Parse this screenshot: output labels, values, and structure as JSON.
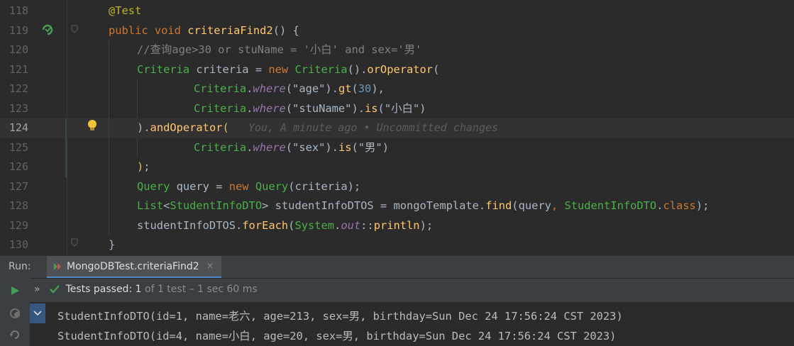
{
  "editor": {
    "lines": [
      {
        "no": "118",
        "tokens": [
          [
            "ann",
            "@Test"
          ]
        ],
        "indent": 0
      },
      {
        "no": "119",
        "tokens": [
          [
            "kw",
            "public "
          ],
          [
            "kw",
            "void "
          ],
          [
            "fn",
            "criteriaFind2"
          ],
          [
            "var",
            "() {"
          ]
        ],
        "indent": 0
      },
      {
        "no": "120",
        "tokens": [
          [
            "cmt",
            "//查询age>30 or stuName = '小白' and sex='男'"
          ]
        ],
        "indent": 1
      },
      {
        "no": "121",
        "tokens": [
          [
            "green",
            "Criteria "
          ],
          [
            "var",
            "criteria "
          ],
          [
            "var",
            "= "
          ],
          [
            "kw",
            "new "
          ],
          [
            "green",
            "Criteria"
          ],
          [
            "var",
            "()."
          ],
          [
            "meth",
            "orOperator"
          ],
          [
            "var",
            "("
          ]
        ],
        "indent": 1
      },
      {
        "no": "122",
        "tokens": [
          [
            "green",
            "Criteria"
          ],
          [
            "var",
            "."
          ],
          [
            "static",
            "where"
          ],
          [
            "var",
            "("
          ],
          [
            "str",
            "\"age\""
          ],
          [
            "var",
            ")."
          ],
          [
            "meth",
            "gt"
          ],
          [
            "var",
            "("
          ],
          [
            "num",
            "30"
          ],
          [
            "var",
            "),"
          ]
        ],
        "indent": 3
      },
      {
        "no": "123",
        "tokens": [
          [
            "green",
            "Criteria"
          ],
          [
            "var",
            "."
          ],
          [
            "static",
            "where"
          ],
          [
            "var",
            "("
          ],
          [
            "str",
            "\"stuName\""
          ],
          [
            "var",
            ")."
          ],
          [
            "meth",
            "is"
          ],
          [
            "var",
            "("
          ],
          [
            "str",
            "\"小白\""
          ],
          [
            "var",
            ")"
          ]
        ],
        "indent": 3
      },
      {
        "no": "124",
        "tokens": [
          [
            "var",
            ")."
          ],
          [
            "meth",
            "andOperator"
          ],
          [
            "paren",
            "("
          ]
        ],
        "indent": 1,
        "inlay": "You, A minute ago • Uncommitted changes",
        "current": true
      },
      {
        "no": "125",
        "tokens": [
          [
            "green",
            "Criteria"
          ],
          [
            "var",
            "."
          ],
          [
            "static",
            "where"
          ],
          [
            "var",
            "("
          ],
          [
            "str",
            "\"sex\""
          ],
          [
            "var",
            ")."
          ],
          [
            "meth",
            "is"
          ],
          [
            "var",
            "("
          ],
          [
            "str",
            "\"男\""
          ],
          [
            "var",
            ")"
          ]
        ],
        "indent": 3
      },
      {
        "no": "126",
        "tokens": [
          [
            "paren",
            ")"
          ],
          [
            "var",
            ";"
          ]
        ],
        "indent": 1
      },
      {
        "no": "127",
        "tokens": [
          [
            "green",
            "Query "
          ],
          [
            "var",
            "query "
          ],
          [
            "var",
            "= "
          ],
          [
            "kw",
            "new "
          ],
          [
            "green",
            "Query"
          ],
          [
            "var",
            "("
          ],
          [
            "var",
            "criteria"
          ],
          [
            "var",
            ");"
          ]
        ],
        "indent": 1
      },
      {
        "no": "128",
        "tokens": [
          [
            "green",
            "List"
          ],
          [
            "var",
            "<"
          ],
          [
            "green",
            "StudentInfoDTO"
          ],
          [
            "var",
            "> "
          ],
          [
            "var",
            "studentInfoDTOS "
          ],
          [
            "var",
            "= "
          ],
          [
            "var",
            "mongoTemplate"
          ],
          [
            "var",
            "."
          ],
          [
            "meth",
            "find"
          ],
          [
            "var",
            "("
          ],
          [
            "var",
            "query"
          ],
          [
            "kw",
            ", "
          ],
          [
            "green",
            "StudentInfoDTO"
          ],
          [
            "var",
            "."
          ],
          [
            "kw",
            "class"
          ],
          [
            "var",
            ");"
          ]
        ],
        "indent": 1
      },
      {
        "no": "129",
        "tokens": [
          [
            "var",
            "studentInfoDTOS"
          ],
          [
            "var",
            "."
          ],
          [
            "meth",
            "forEach"
          ],
          [
            "var",
            "("
          ],
          [
            "green",
            "System"
          ],
          [
            "var",
            "."
          ],
          [
            "field",
            "out"
          ],
          [
            "var",
            "::"
          ],
          [
            "meth",
            "println"
          ],
          [
            "var",
            ");"
          ]
        ],
        "indent": 1
      },
      {
        "no": "130",
        "tokens": [
          [
            "var",
            "}"
          ]
        ],
        "indent": 0
      }
    ]
  },
  "run_panel": {
    "label": "Run:",
    "tab_label": "MongoDBTest.criteriaFind2",
    "tab_close": "×",
    "expand_glyph": "»",
    "tests_passed": "Tests passed:",
    "tests_count": "1",
    "tests_detail": "of 1 test – 1 sec 60 ms",
    "output": [
      "StudentInfoDTO(id=1, name=老六, age=213, sex=男, birthday=Sun Dec 24 17:56:24 CST 2023)",
      "StudentInfoDTO(id=4, name=小白, age=20, sex=男, birthday=Sun Dec 24 17:56:24 CST 2023)"
    ]
  },
  "colors": {
    "accent": "#4a88c7",
    "pass_green": "#499c54"
  }
}
